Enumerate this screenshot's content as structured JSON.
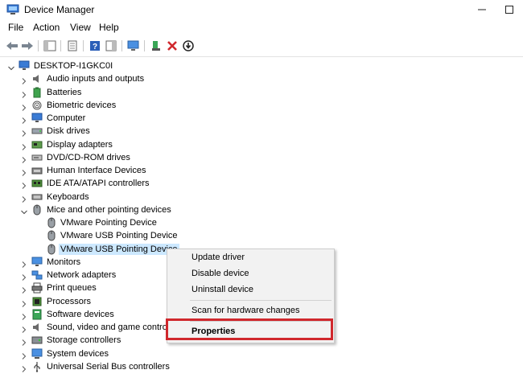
{
  "window": {
    "title": "Device Manager",
    "app_icon": "device-manager-icon",
    "controls": [
      "minimize-icon",
      "maximize-icon",
      "close-icon"
    ]
  },
  "menubar": {
    "items": [
      "File",
      "Action",
      "View",
      "Help"
    ]
  },
  "toolbar": {
    "buttons": [
      "back-arrow-icon",
      "forward-arrow-icon",
      "show-hide-console-tree-icon",
      "properties-icon",
      "help-icon",
      "action-pane-icon",
      "scan-hardware-icon",
      "update-driver-icon",
      "uninstall-device-icon",
      "disable-device-icon"
    ]
  },
  "tree": {
    "root": "DESKTOP-I1GKC0I",
    "categories": [
      {
        "label": "Audio inputs and outputs",
        "icon": "speaker-icon"
      },
      {
        "label": "Batteries",
        "icon": "battery-icon"
      },
      {
        "label": "Biometric devices",
        "icon": "fingerprint-icon"
      },
      {
        "label": "Computer",
        "icon": "computer-monitor-icon"
      },
      {
        "label": "Disk drives",
        "icon": "disk-drive-icon"
      },
      {
        "label": "Display adapters",
        "icon": "display-adapter-icon"
      },
      {
        "label": "DVD/CD-ROM drives",
        "icon": "dvd-drive-icon"
      },
      {
        "label": "Human Interface Devices",
        "icon": "hid-icon"
      },
      {
        "label": "IDE ATA/ATAPI controllers",
        "icon": "ide-controller-icon"
      },
      {
        "label": "Keyboards",
        "icon": "keyboard-icon"
      },
      {
        "label": "Mice and other pointing devices",
        "icon": "mouse-icon",
        "expanded": true,
        "children": [
          "VMware Pointing Device",
          "VMware USB Pointing Device",
          "VMware USB Pointing Device"
        ]
      },
      {
        "label": "Monitors",
        "icon": "monitor-icon"
      },
      {
        "label": "Network adapters",
        "icon": "network-adapter-icon"
      },
      {
        "label": "Print queues",
        "icon": "printer-icon"
      },
      {
        "label": "Processors",
        "icon": "processor-icon"
      },
      {
        "label": "Software devices",
        "icon": "software-device-icon"
      },
      {
        "label": "Sound, video and game controllers",
        "icon": "speaker-icon"
      },
      {
        "label": "Storage controllers",
        "icon": "storage-controller-icon"
      },
      {
        "label": "System devices",
        "icon": "system-devices-icon"
      },
      {
        "label": "Universal Serial Bus controllers",
        "icon": "usb-icon"
      }
    ],
    "selected_child": 2
  },
  "context_menu": {
    "items": [
      {
        "label": "Update driver"
      },
      {
        "label": "Disable device"
      },
      {
        "label": "Uninstall device"
      },
      {
        "label": "Scan for hardware changes"
      },
      {
        "label": "Properties",
        "bold": true,
        "highlighted": true
      }
    ]
  },
  "colors": {
    "selection": "#cce8ff",
    "highlight_border": "#d0282d",
    "menu_background": "#f2f2f2"
  }
}
